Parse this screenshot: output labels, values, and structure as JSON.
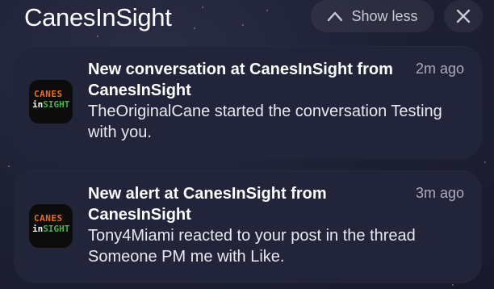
{
  "header": {
    "group_title": "CanesInSight",
    "show_less_label": "Show less"
  },
  "app_logo": {
    "line1": "CANES",
    "line2_a": "in",
    "line2_b": "SIGHT"
  },
  "notifications": [
    {
      "title": "New conversation at CanesInSight from CanesInSight",
      "time": "2m ago",
      "body": "TheOriginalCane started the conversation Testing with you."
    },
    {
      "title": "New alert at CanesInSight from CanesInSight",
      "time": "3m ago",
      "body": "Tony4Miami reacted to your post in the thread Someone PM me with Like."
    }
  ],
  "colors": {
    "background": "#1d1f33",
    "card": "#22253a",
    "logo_orange": "#f26b1d",
    "logo_green": "#4caf50"
  },
  "icons": [
    "chevron-up-icon",
    "close-icon",
    "app-icon"
  ]
}
